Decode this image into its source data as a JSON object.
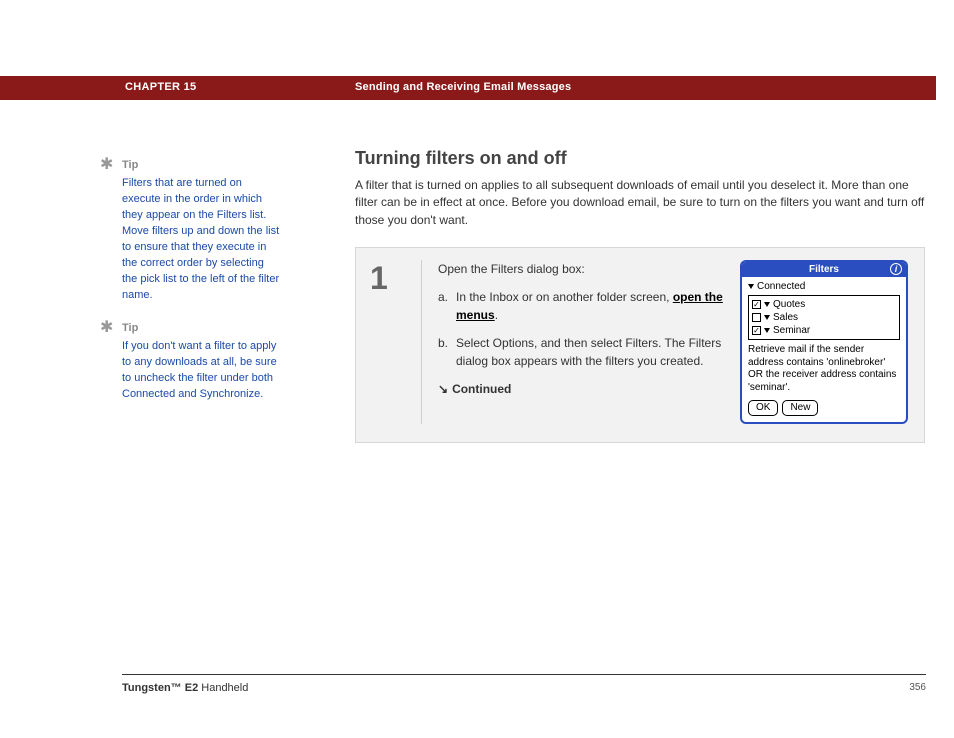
{
  "header": {
    "chapter": "CHAPTER 15",
    "title": "Sending and Receiving Email Messages"
  },
  "sidebar": {
    "tips": [
      {
        "label": "Tip",
        "text": "Filters that are turned on execute in the order in which they appear on the Filters list. Move filters up and down the list to ensure that they execute in the correct order by selecting the pick list to the left of the filter name."
      },
      {
        "label": "Tip",
        "text": "If you don't want a filter to apply to any downloads at all, be sure to uncheck the filter under both Connected and Synchronize."
      }
    ]
  },
  "main": {
    "heading": "Turning filters on and off",
    "intro": "A filter that is turned on applies to all subsequent downloads of email until you deselect it. More than one filter can be in effect at once. Before you download email, be sure to turn on the filters you want and turn off those you don't want.",
    "step": {
      "number": "1",
      "lead": "Open the Filters dialog box:",
      "subs": [
        {
          "k": "a.",
          "pre": "In the Inbox or on another folder screen, ",
          "link": "open the menus",
          "post": "."
        },
        {
          "k": "b.",
          "pre": "Select Options, and then select Filters. The Filters dialog box appears with the filters you created.",
          "link": "",
          "post": ""
        }
      ],
      "continued": "Continued"
    }
  },
  "palm": {
    "title": "Filters",
    "dropdown": "Connected",
    "items": [
      {
        "checked": true,
        "label": "Quotes"
      },
      {
        "checked": false,
        "label": "Sales"
      },
      {
        "checked": true,
        "label": "Seminar"
      }
    ],
    "desc": "Retrieve mail if the sender address contains 'onlinebroker' OR the receiver address contains 'seminar'.",
    "btn_ok": "OK",
    "btn_new": "New"
  },
  "footer": {
    "product_bold": "Tungsten™ E2",
    "product_rest": " Handheld",
    "page": "356"
  }
}
